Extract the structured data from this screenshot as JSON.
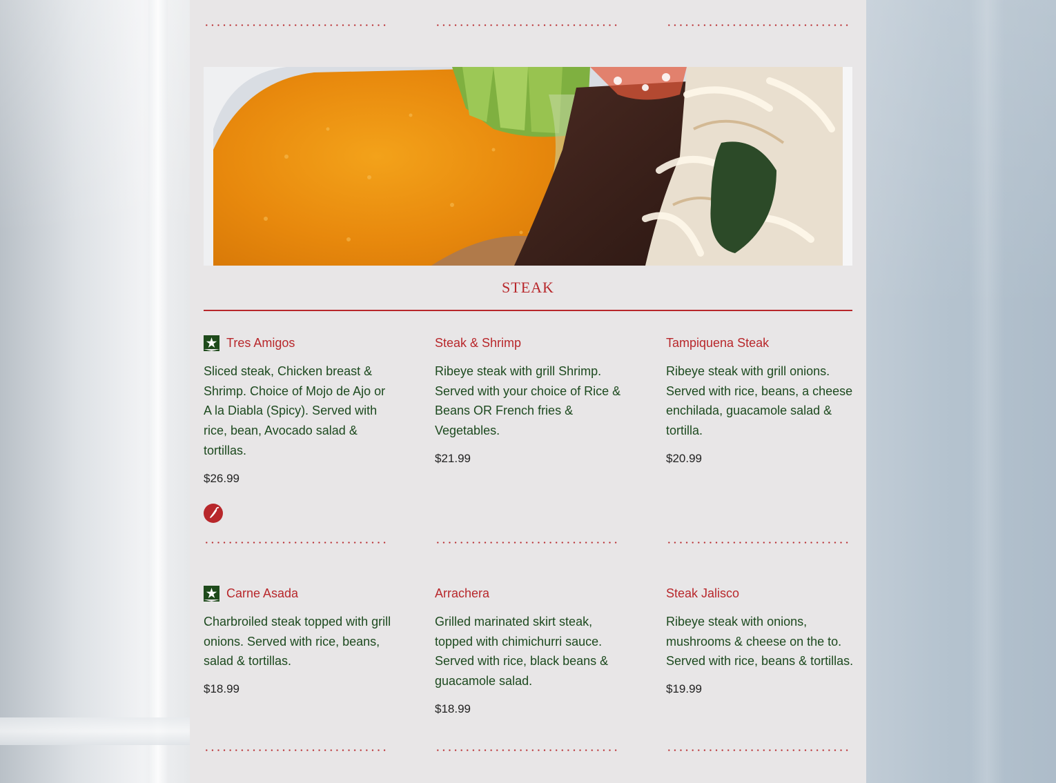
{
  "section": {
    "title": "STEAK",
    "hero_image_alt": "Steak plate with rice and avocado"
  },
  "items": [
    {
      "name": "Tres Amigos",
      "badge": "star-icon",
      "description": "Sliced steak, Chicken breast & Shrimp. Choice of Mojo de Ajo or A la Diabla (Spicy). Served with rice, bean, Avocado salad & tortillas.",
      "price": "$26.99",
      "spicy_icon": "chili-icon"
    },
    {
      "name": "Steak & Shrimp",
      "description": "Ribeye steak with grill Shrimp. Served with your choice of Rice & Beans OR French fries & Vegetables.",
      "price": "$21.99"
    },
    {
      "name": "Tampiquena Steak",
      "description": "Ribeye steak with grill onions. Served with rice, beans, a cheese enchilada, guacamole salad & tortilla.",
      "price": "$20.99"
    },
    {
      "name": "Carne Asada",
      "badge": "star-icon",
      "description": "Charbroiled steak topped with grill onions. Served with rice, beans, salad & tortillas.",
      "price": "$18.99"
    },
    {
      "name": "Arrachera",
      "description": "Grilled marinated skirt steak, topped with chimichurri sauce. Served with rice, black beans & guacamole salad.",
      "price": "$18.99"
    },
    {
      "name": "Steak Jalisco",
      "description": "Ribeye steak with onions, mushrooms & cheese on the to. Served with rice, beans & tortillas.",
      "price": "$19.99"
    }
  ],
  "colors": {
    "accent_red": "#b8272b",
    "text_green": "#1d4a1f",
    "badge_green": "#1e4a1b",
    "panel_bg": "#e8e6e7"
  }
}
